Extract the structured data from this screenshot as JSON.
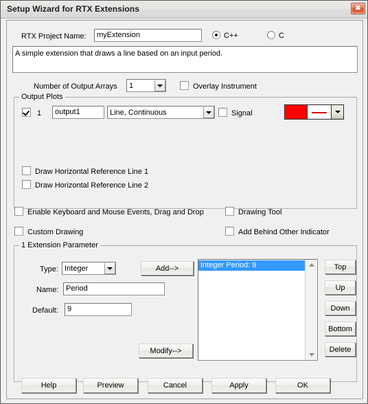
{
  "window": {
    "title": "Setup Wizard for RTX Extensions",
    "close_icon": "close-icon",
    "close_glyph": "✖"
  },
  "project": {
    "name_label": "RTX Project Name:",
    "name_value": "myExtension",
    "name_placeholder": "",
    "language_options": [
      {
        "label": "C++",
        "selected": true
      },
      {
        "label": "C",
        "selected": false
      }
    ],
    "description_value": "A simple extension that draws a line based on an input period.",
    "description_placeholder": ""
  },
  "output": {
    "arrays_label": "Number of Output Arrays",
    "arrays_value": "1",
    "overlay_label": "Overlay Instrument",
    "overlay_checked": false,
    "group_title": "Output Plots",
    "plots": [
      {
        "enabled": true,
        "index": "1",
        "name": "output1",
        "style": "Line, Continuous",
        "signal_label": "Signal",
        "signal_checked": false,
        "color": "#ff0000",
        "line_color": "#e00000"
      }
    ],
    "ref_line_1_label": "Draw Horizontal Reference Line 1",
    "ref_line_1_checked": false,
    "ref_line_2_label": "Draw Horizontal Reference Line 2",
    "ref_line_2_checked": false
  },
  "options": {
    "enable_events_label": "Enable Keyboard and Mouse Events, Drag and Drop",
    "enable_events_checked": false,
    "drawing_tool_label": "Drawing Tool",
    "drawing_tool_checked": false,
    "custom_drawing_label": "Custom Drawing",
    "custom_drawing_checked": false,
    "add_behind_label": "Add Behind Other Indicator",
    "add_behind_checked": false
  },
  "parameters": {
    "group_title": "1 Extension Parameter",
    "type_label": "Type:",
    "type_value": "Integer",
    "name_label": "Name:",
    "name_value": "Period",
    "name_placeholder": "",
    "default_label": "Default:",
    "default_value": "9",
    "default_placeholder": "",
    "add_button": "Add-->",
    "modify_button": "Modify-->",
    "list_items": [
      {
        "text": "Integer Period: 9",
        "selected": true
      }
    ],
    "side_buttons": [
      {
        "label": "Top"
      },
      {
        "label": "Up"
      },
      {
        "label": "Down"
      },
      {
        "label": "Bottom"
      },
      {
        "label": "Delete"
      }
    ]
  },
  "footer": {
    "buttons": [
      {
        "label": "Help"
      },
      {
        "label": "Preview"
      },
      {
        "label": "Cancel"
      },
      {
        "label": "Apply"
      },
      {
        "label": "OK"
      }
    ]
  }
}
